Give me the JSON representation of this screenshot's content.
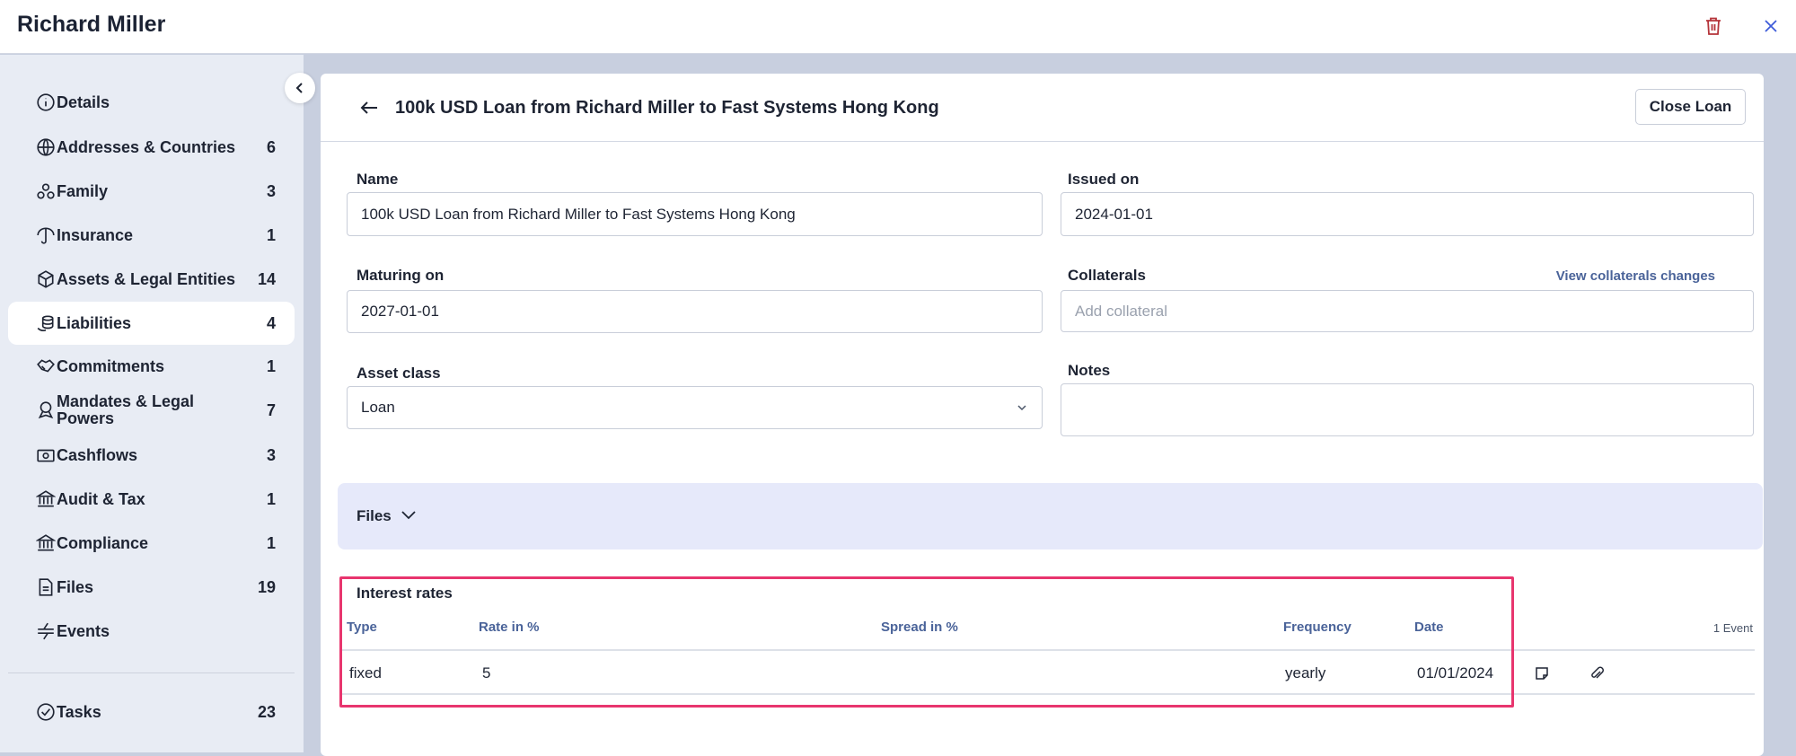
{
  "header": {
    "title": "Richard Miller",
    "delete_icon": "trash-icon",
    "close_icon": "close-icon",
    "delete_color": "#b5343a",
    "close_color": "#3d5bd9"
  },
  "sidebar": {
    "items": [
      {
        "label": "Details",
        "count": "",
        "icon": "info-icon"
      },
      {
        "label": "Addresses & Countries",
        "count": "6",
        "icon": "globe-icon"
      },
      {
        "label": "Family",
        "count": "3",
        "icon": "people-icon"
      },
      {
        "label": "Insurance",
        "count": "1",
        "icon": "umbrella-icon"
      },
      {
        "label": "Assets & Legal Entities",
        "count": "14",
        "icon": "box-icon"
      },
      {
        "label": "Liabilities",
        "count": "4",
        "icon": "coins-icon",
        "active": true
      },
      {
        "label": "Commitments",
        "count": "1",
        "icon": "handshake-icon"
      },
      {
        "label": "Mandates & Legal Powers",
        "count": "7",
        "icon": "award-icon"
      },
      {
        "label": "Cashflows",
        "count": "3",
        "icon": "banknote-icon"
      },
      {
        "label": "Audit & Tax",
        "count": "1",
        "icon": "bank-icon"
      },
      {
        "label": "Compliance",
        "count": "1",
        "icon": "bank-icon"
      },
      {
        "label": "Files",
        "count": "19",
        "icon": "file-icon"
      },
      {
        "label": "Events",
        "count": "",
        "icon": "events-icon"
      }
    ],
    "tasks": {
      "label": "Tasks",
      "count": "23",
      "icon": "check-circle-icon"
    }
  },
  "main": {
    "title": "100k USD Loan from Richard Miller to Fast Systems Hong Kong",
    "close_loan": "Close Loan",
    "form": {
      "name_label": "Name",
      "name_value": "100k USD Loan from Richard Miller to Fast Systems Hong Kong",
      "issued_label": "Issued on",
      "issued_value": "2024-01-01",
      "maturing_label": "Maturing on",
      "maturing_value": "2027-01-01",
      "collaterals_label": "Collaterals",
      "collaterals_placeholder": "Add collateral",
      "collaterals_link": "View collaterals changes",
      "asset_class_label": "Asset class",
      "asset_class_value": "Loan",
      "notes_label": "Notes",
      "notes_value": ""
    },
    "files_label": "Files",
    "interest": {
      "title": "Interest rates",
      "columns": [
        "Type",
        "Rate in %",
        "Spread in %",
        "Frequency",
        "Date"
      ],
      "events": "1 Event",
      "rows": [
        {
          "type": "fixed",
          "rate": "5",
          "spread": "",
          "frequency": "yearly",
          "date": "01/01/2024"
        }
      ],
      "highlight_color": "#e8356e"
    }
  }
}
